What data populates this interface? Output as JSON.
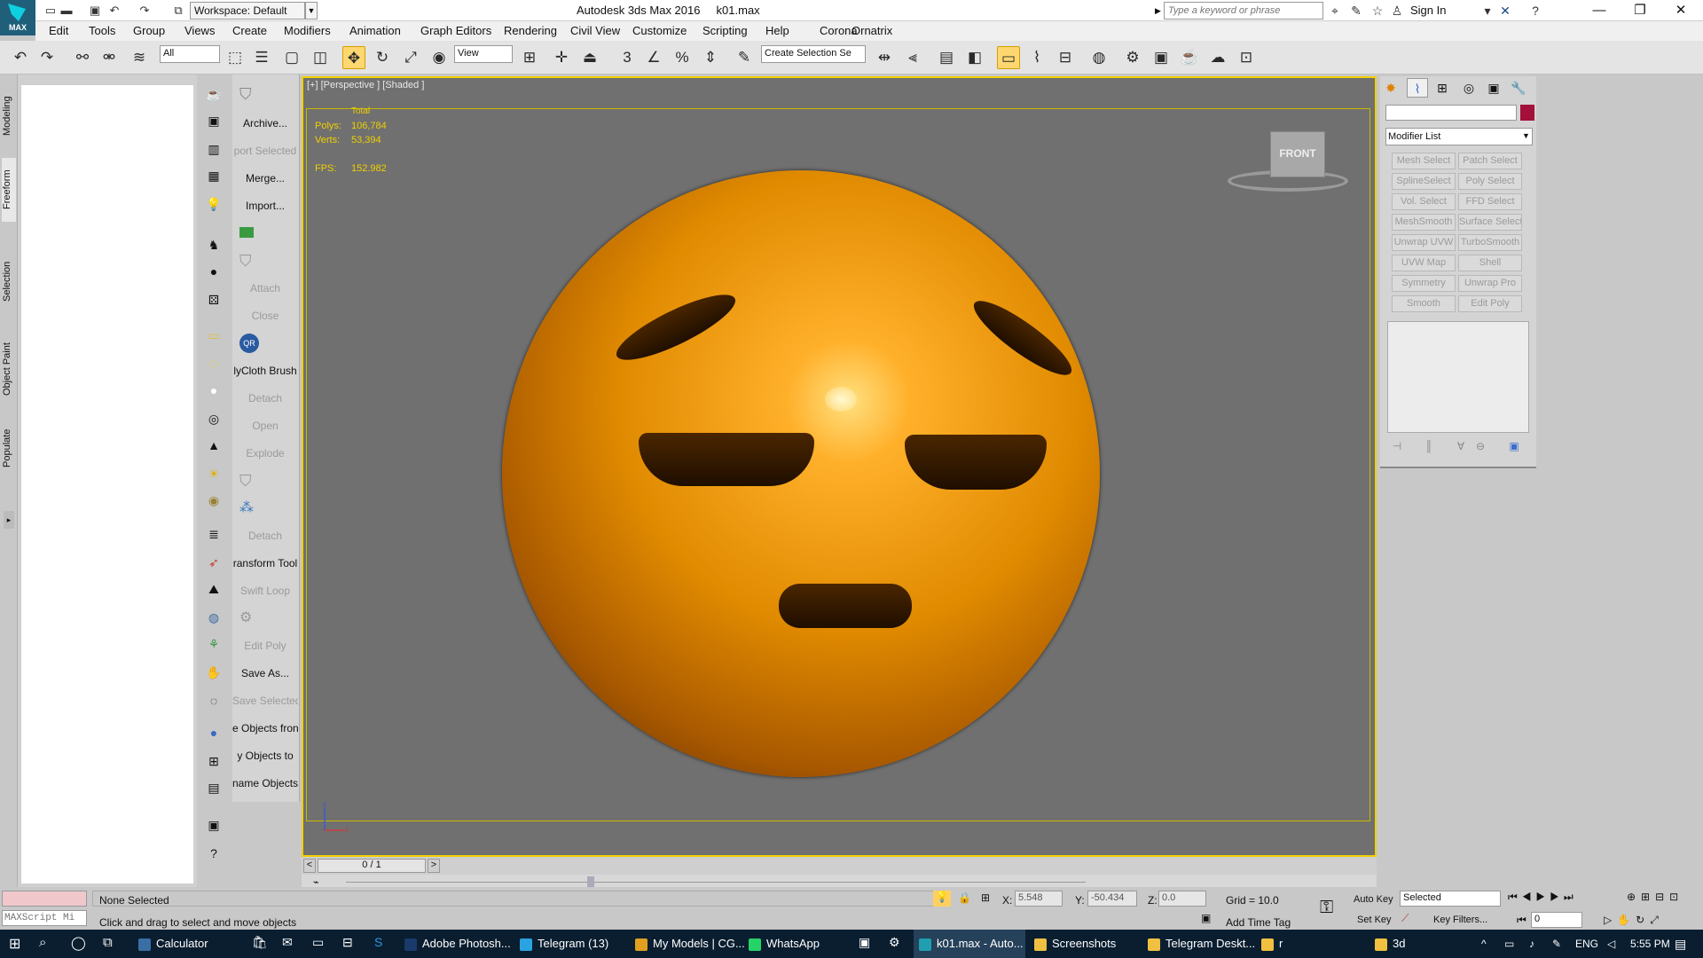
{
  "app": {
    "title": "Autodesk 3ds Max 2016",
    "file": "k01.max",
    "logo": "MAX",
    "workspace": "Workspace: Default",
    "search_placeholder": "Type a keyword or phrase",
    "sign_in": "Sign In"
  },
  "menu": [
    "Edit",
    "Tools",
    "Group",
    "Views",
    "Create",
    "Modifiers",
    "Animation",
    "Graph Editors",
    "Rendering",
    "Civil View",
    "Customize",
    "Scripting",
    "Help",
    "Corona",
    "Ornatrix"
  ],
  "toolbar": {
    "filter": "All",
    "ref_coord": "View",
    "selection_set": "Create Selection Se"
  },
  "left_tabs": [
    "Modeling",
    "Freeform",
    "Selection",
    "Object Paint",
    "Populate"
  ],
  "ribbon": [
    {
      "label": "Archive...",
      "enabled": true
    },
    {
      "label": "port Selected",
      "enabled": false
    },
    {
      "label": "Merge...",
      "enabled": true
    },
    {
      "label": "Import...",
      "enabled": true
    },
    {
      "label": "Attach",
      "enabled": false
    },
    {
      "label": "Close",
      "enabled": false
    },
    {
      "label": "lyCloth Brush",
      "enabled": true
    },
    {
      "label": "Detach",
      "enabled": false
    },
    {
      "label": "Open",
      "enabled": false
    },
    {
      "label": "Explode",
      "enabled": false
    },
    {
      "label": "Detach",
      "enabled": false
    },
    {
      "label": "ransform Tool",
      "enabled": true
    },
    {
      "label": "Swift Loop",
      "enabled": false
    },
    {
      "label": "Edit Poly",
      "enabled": false
    },
    {
      "label": "Save As...",
      "enabled": true
    },
    {
      "label": "Save Selected",
      "enabled": false
    },
    {
      "label": "e Objects fron",
      "enabled": true
    },
    {
      "label": "y Objects to",
      "enabled": true
    },
    {
      "label": "name Objects",
      "enabled": true
    }
  ],
  "viewport": {
    "label": "[+] [Perspective ] [Shaded ]",
    "stats": {
      "total": "Total",
      "polys_label": "Polys:",
      "polys": "106,784",
      "verts_label": "Verts:",
      "verts": "53,394",
      "fps_label": "FPS:",
      "fps": "152.982"
    },
    "viewcube": "FRONT"
  },
  "timeline": {
    "frame": "0 / 1",
    "prev": "<",
    "next": ">"
  },
  "command_panel": {
    "modifier_list": "Modifier List",
    "accent_color": "#a3103a",
    "modifiers": [
      "Mesh Select",
      "Patch Select",
      "SplineSelect",
      "Poly Select",
      "Vol. Select",
      "FFD Select",
      "MeshSmooth",
      "Surface Select",
      "Unwrap UVW",
      "TurboSmooth",
      "UVW Map",
      "Shell",
      "Symmetry",
      "Unwrap Pro",
      "Smooth",
      "Edit Poly"
    ]
  },
  "status": {
    "maxscript": "MAXScript Mi",
    "selection": "None Selected",
    "prompt": "Click and drag to select and move objects",
    "x_label": "X:",
    "x": "5.548",
    "y_label": "Y:",
    "y": "-50.434",
    "z_label": "Z:",
    "z": "0.0",
    "grid": "Grid = 10.0",
    "add_time_tag": "Add Time Tag",
    "auto_key": "Auto Key",
    "set_key": "Set Key",
    "key_mode": "Selected",
    "key_filters": "Key Filters...",
    "frame": "0"
  },
  "taskbar": {
    "items": [
      {
        "label": "Calculator",
        "color": "#3a6ea5"
      },
      {
        "label": "Adobe Photosh...",
        "color": "#1a3a6a"
      },
      {
        "label": "Telegram (13)",
        "color": "#2aa3e0"
      },
      {
        "label": "My Models | CG...",
        "color": "#e0a020"
      },
      {
        "label": "WhatsApp",
        "color": "#25d366"
      },
      {
        "label": "k01.max - Auto...",
        "color": "#1f9fb0"
      },
      {
        "label": "Screenshots",
        "color": "#f0c040"
      },
      {
        "label": "Telegram Deskt...",
        "color": "#f0c040"
      },
      {
        "label": "r",
        "color": "#f0c040"
      },
      {
        "label": "3d",
        "color": "#f0c040"
      }
    ],
    "lang": "ENG",
    "time": "5:55 PM"
  }
}
